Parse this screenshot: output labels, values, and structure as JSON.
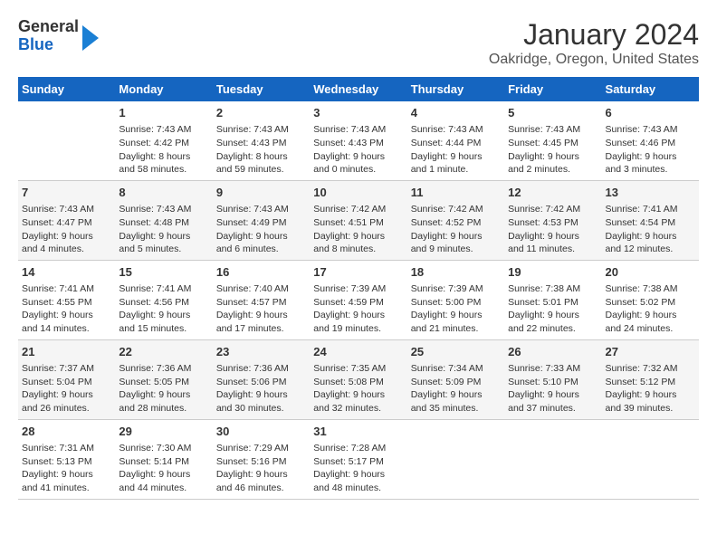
{
  "header": {
    "logo": {
      "general": "General",
      "blue": "Blue"
    },
    "title": "January 2024",
    "subtitle": "Oakridge, Oregon, United States"
  },
  "weekdays": [
    "Sunday",
    "Monday",
    "Tuesday",
    "Wednesday",
    "Thursday",
    "Friday",
    "Saturday"
  ],
  "weeks": [
    [
      {
        "day": "",
        "info": ""
      },
      {
        "day": "1",
        "info": "Sunrise: 7:43 AM\nSunset: 4:42 PM\nDaylight: 8 hours\nand 58 minutes."
      },
      {
        "day": "2",
        "info": "Sunrise: 7:43 AM\nSunset: 4:43 PM\nDaylight: 8 hours\nand 59 minutes."
      },
      {
        "day": "3",
        "info": "Sunrise: 7:43 AM\nSunset: 4:43 PM\nDaylight: 9 hours\nand 0 minutes."
      },
      {
        "day": "4",
        "info": "Sunrise: 7:43 AM\nSunset: 4:44 PM\nDaylight: 9 hours\nand 1 minute."
      },
      {
        "day": "5",
        "info": "Sunrise: 7:43 AM\nSunset: 4:45 PM\nDaylight: 9 hours\nand 2 minutes."
      },
      {
        "day": "6",
        "info": "Sunrise: 7:43 AM\nSunset: 4:46 PM\nDaylight: 9 hours\nand 3 minutes."
      }
    ],
    [
      {
        "day": "7",
        "info": "Sunrise: 7:43 AM\nSunset: 4:47 PM\nDaylight: 9 hours\nand 4 minutes."
      },
      {
        "day": "8",
        "info": "Sunrise: 7:43 AM\nSunset: 4:48 PM\nDaylight: 9 hours\nand 5 minutes."
      },
      {
        "day": "9",
        "info": "Sunrise: 7:43 AM\nSunset: 4:49 PM\nDaylight: 9 hours\nand 6 minutes."
      },
      {
        "day": "10",
        "info": "Sunrise: 7:42 AM\nSunset: 4:51 PM\nDaylight: 9 hours\nand 8 minutes."
      },
      {
        "day": "11",
        "info": "Sunrise: 7:42 AM\nSunset: 4:52 PM\nDaylight: 9 hours\nand 9 minutes."
      },
      {
        "day": "12",
        "info": "Sunrise: 7:42 AM\nSunset: 4:53 PM\nDaylight: 9 hours\nand 11 minutes."
      },
      {
        "day": "13",
        "info": "Sunrise: 7:41 AM\nSunset: 4:54 PM\nDaylight: 9 hours\nand 12 minutes."
      }
    ],
    [
      {
        "day": "14",
        "info": "Sunrise: 7:41 AM\nSunset: 4:55 PM\nDaylight: 9 hours\nand 14 minutes."
      },
      {
        "day": "15",
        "info": "Sunrise: 7:41 AM\nSunset: 4:56 PM\nDaylight: 9 hours\nand 15 minutes."
      },
      {
        "day": "16",
        "info": "Sunrise: 7:40 AM\nSunset: 4:57 PM\nDaylight: 9 hours\nand 17 minutes."
      },
      {
        "day": "17",
        "info": "Sunrise: 7:39 AM\nSunset: 4:59 PM\nDaylight: 9 hours\nand 19 minutes."
      },
      {
        "day": "18",
        "info": "Sunrise: 7:39 AM\nSunset: 5:00 PM\nDaylight: 9 hours\nand 21 minutes."
      },
      {
        "day": "19",
        "info": "Sunrise: 7:38 AM\nSunset: 5:01 PM\nDaylight: 9 hours\nand 22 minutes."
      },
      {
        "day": "20",
        "info": "Sunrise: 7:38 AM\nSunset: 5:02 PM\nDaylight: 9 hours\nand 24 minutes."
      }
    ],
    [
      {
        "day": "21",
        "info": "Sunrise: 7:37 AM\nSunset: 5:04 PM\nDaylight: 9 hours\nand 26 minutes."
      },
      {
        "day": "22",
        "info": "Sunrise: 7:36 AM\nSunset: 5:05 PM\nDaylight: 9 hours\nand 28 minutes."
      },
      {
        "day": "23",
        "info": "Sunrise: 7:36 AM\nSunset: 5:06 PM\nDaylight: 9 hours\nand 30 minutes."
      },
      {
        "day": "24",
        "info": "Sunrise: 7:35 AM\nSunset: 5:08 PM\nDaylight: 9 hours\nand 32 minutes."
      },
      {
        "day": "25",
        "info": "Sunrise: 7:34 AM\nSunset: 5:09 PM\nDaylight: 9 hours\nand 35 minutes."
      },
      {
        "day": "26",
        "info": "Sunrise: 7:33 AM\nSunset: 5:10 PM\nDaylight: 9 hours\nand 37 minutes."
      },
      {
        "day": "27",
        "info": "Sunrise: 7:32 AM\nSunset: 5:12 PM\nDaylight: 9 hours\nand 39 minutes."
      }
    ],
    [
      {
        "day": "28",
        "info": "Sunrise: 7:31 AM\nSunset: 5:13 PM\nDaylight: 9 hours\nand 41 minutes."
      },
      {
        "day": "29",
        "info": "Sunrise: 7:30 AM\nSunset: 5:14 PM\nDaylight: 9 hours\nand 44 minutes."
      },
      {
        "day": "30",
        "info": "Sunrise: 7:29 AM\nSunset: 5:16 PM\nDaylight: 9 hours\nand 46 minutes."
      },
      {
        "day": "31",
        "info": "Sunrise: 7:28 AM\nSunset: 5:17 PM\nDaylight: 9 hours\nand 48 minutes."
      },
      {
        "day": "",
        "info": ""
      },
      {
        "day": "",
        "info": ""
      },
      {
        "day": "",
        "info": ""
      }
    ]
  ]
}
